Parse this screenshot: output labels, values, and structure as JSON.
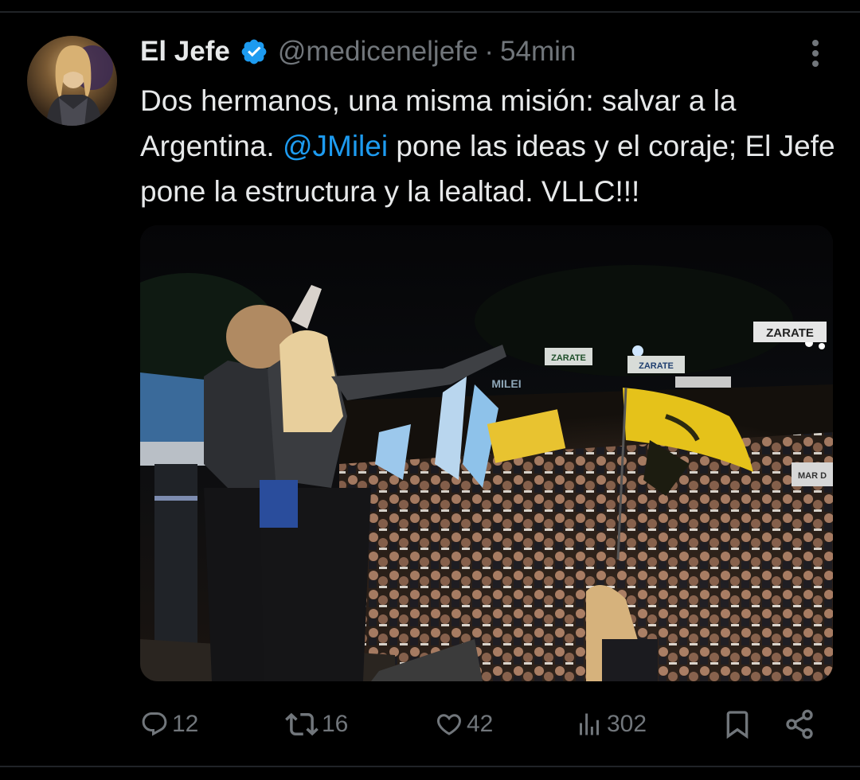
{
  "tweet": {
    "display_name": "El Jefe",
    "handle": "@mediceneljefe",
    "separator": "·",
    "time": "54min",
    "text_part1": "Dos hermanos, una misma misión: salvar a la Argentina. ",
    "mention": "@JMilei",
    "text_part2": " pone las ideas y el coraje; El Jefe pone la estructura y la lealtad. VLLC!!!",
    "image_signs": [
      "ZARATE",
      "ZARATE",
      "ZARATE",
      "MILEI",
      "MAR D"
    ]
  },
  "actions": {
    "replies": "12",
    "retweets": "16",
    "likes": "42",
    "views": "302"
  },
  "colors": {
    "background": "#000000",
    "text": "#e7e9ea",
    "secondary": "#71767b",
    "accent": "#1d9bf0"
  }
}
